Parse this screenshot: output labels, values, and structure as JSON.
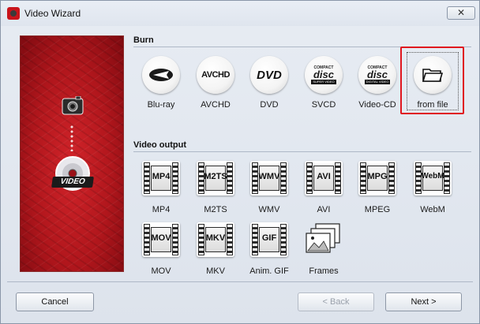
{
  "window": {
    "title": "Video Wizard",
    "close_glyph": "✕"
  },
  "sidebar": {
    "badge_text": "VIDEO"
  },
  "burn": {
    "title": "Burn",
    "items": [
      {
        "label": "Blu-ray",
        "icon": "bluray-icon"
      },
      {
        "label": "AVCHD",
        "icon": "avchd-icon",
        "text": "AVCHD"
      },
      {
        "label": "DVD",
        "icon": "dvd-icon",
        "text": "DVD"
      },
      {
        "label": "SVCD",
        "icon": "svcd-icon",
        "text": "disc",
        "top": "COMPACT",
        "sub": "SUPER VIDEO"
      },
      {
        "label": "Video-CD",
        "icon": "vcd-icon",
        "text": "disc",
        "top": "COMPACT",
        "sub": "DIGITAL VIDEO"
      },
      {
        "label": "from file",
        "icon": "folder-icon",
        "selected": true
      }
    ]
  },
  "video_output": {
    "title": "Video output",
    "items": [
      {
        "label": "MP4",
        "fmt": "MP4"
      },
      {
        "label": "M2TS",
        "fmt": "M2TS"
      },
      {
        "label": "WMV",
        "fmt": "WMV"
      },
      {
        "label": "AVI",
        "fmt": "AVI"
      },
      {
        "label": "MPEG",
        "fmt": "MPG"
      },
      {
        "label": "WebM",
        "fmt": "WebM"
      },
      {
        "label": "MOV",
        "fmt": "MOV"
      },
      {
        "label": "MKV",
        "fmt": "MKV"
      },
      {
        "label": "Anim. GIF",
        "fmt": "GIF"
      },
      {
        "label": "Frames",
        "fmt": ""
      }
    ]
  },
  "footer": {
    "cancel": "Cancel",
    "back": "< Back",
    "next": "Next >"
  },
  "colors": {
    "accent_red": "#e0161e",
    "sidebar_red": "#b0161c"
  }
}
